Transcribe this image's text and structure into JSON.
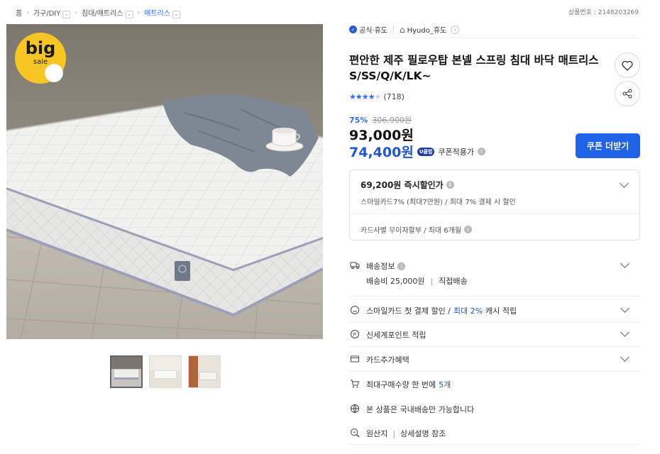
{
  "breadcrumb": {
    "home": "홈",
    "items": [
      "가구/DIY",
      "침대/매트리스",
      "매트리스"
    ]
  },
  "product_number": "상품번호 : 2148203269",
  "promo_badge": {
    "line1": "big",
    "line2": "sale"
  },
  "seller": {
    "official_label": "공식·휴도",
    "store_name": "Hyudo_휴도"
  },
  "title": "편안한 제주 필로우탑 본넬 스프링 침대 바닥 매트리스 S/SS/Q/K/LK~",
  "rating": {
    "stars": 4.3,
    "count": "(718)"
  },
  "pricing": {
    "discount_pct": "75%",
    "original_price": "306,900원",
    "price": "93,000원",
    "coupon_price": "74,400원",
    "coupon_badge": "U클럽",
    "coupon_label": "쿠폰적용가",
    "coupon_button": "쿠폰 더받기"
  },
  "instant_discount": {
    "price": "69,200원 즉시할인가",
    "detail": "스마일카드7% (최대7만원) / 최대 7% 결제 시 할인",
    "installment": "카드사별 무이자할부 / 최대 6개월"
  },
  "shipping": {
    "label": "배송정보",
    "fee": "배송비 25,000원",
    "type": "직접배송"
  },
  "benefits": {
    "smilecard_prefix": "스마일카드 첫 결제 할인 /",
    "smilecard_highlight": "최대 2%",
    "smilecard_suffix": "캐시 적립",
    "shinsegae": "신세계포인트 적립",
    "card_extra": "카드추가혜택",
    "max_qty_prefix": "최대구매수량 한 번에",
    "max_qty_value": "5개",
    "domestic": "본 상품은 국내배송만 가능합니다",
    "origin_label": "원산지",
    "origin_value": "상세설명 참조"
  },
  "colors": {
    "accent": "#1e63e8",
    "price_blue": "#1e57d6"
  }
}
